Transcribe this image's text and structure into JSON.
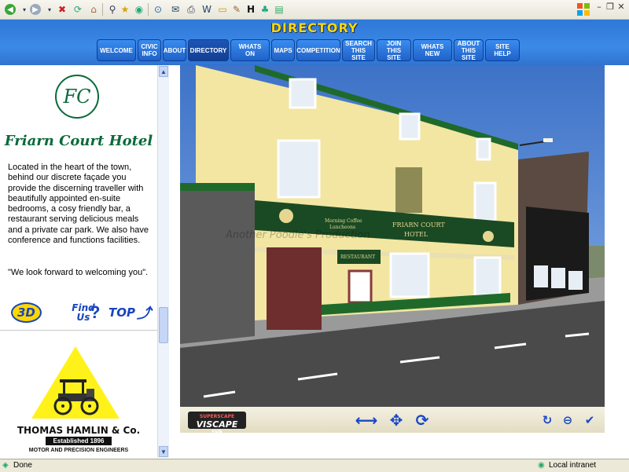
{
  "toolbar": {
    "buttons": [
      "back-icon",
      "forward-icon",
      "stop-icon",
      "refresh-icon",
      "home-icon",
      "search-icon",
      "favorites-icon",
      "media-icon",
      "history-icon",
      "mail-icon",
      "print-icon",
      "edit-icon",
      "discuss-icon",
      "messenger-icon",
      "folder-icon"
    ],
    "accent": "#2e78d8"
  },
  "header": {
    "title": "DIRECTORY",
    "nav": [
      {
        "label": "WELCOME"
      },
      {
        "label": "CIVIC\nINFO"
      },
      {
        "label": "ABOUT"
      },
      {
        "label": "DIRECTORY",
        "active": true
      },
      {
        "label": "WHATS ON"
      },
      {
        "label": "MAPS"
      },
      {
        "label": "COMPETITION"
      },
      {
        "label": "SEARCH\nTHIS SITE"
      },
      {
        "label": "JOIN THIS\nSITE"
      },
      {
        "label": "WHATS NEW"
      },
      {
        "label": "ABOUT\nTHIS SITE"
      },
      {
        "label": "SITE HELP"
      }
    ]
  },
  "sidebar": {
    "logo_monogram": "FC",
    "hotel_name": "Friarn Court Hotel",
    "description": "Located in the heart of the town, behind our discrete façade you provide the discerning traveller with beautifully appointed en-suite bedrooms, a cosy friendly bar, a restaurant serving delicious meals and a private car park.  We also have conference and functions facilities.",
    "quote": "\"We look forward to welcoming you\".",
    "icons": {
      "btn3d": "3D",
      "find1": "Find",
      "find2": "Us",
      "top": "TOP"
    },
    "ad": {
      "name": "THOMAS HAMLIN & Co.",
      "established": "Established 1896",
      "subtitle": "MOTOR AND PRECISION ENGINEERS",
      "color": "#fff21a"
    }
  },
  "scene": {
    "sign_name1": "FRIARN COURT",
    "sign_name2": "HOTEL",
    "sign_left1": "Morning Coffee",
    "sign_left2": "Luncheons",
    "sign_restaurant": "RESTAURANT",
    "watermark": "Another Poodle's Production"
  },
  "viewer_controls": {
    "logo_top": "SUPERSCAPE",
    "logo_main": "VISCAPE",
    "logo_bottom": "SVR"
  },
  "status": {
    "left": "Done",
    "zone": "Local intranet"
  }
}
